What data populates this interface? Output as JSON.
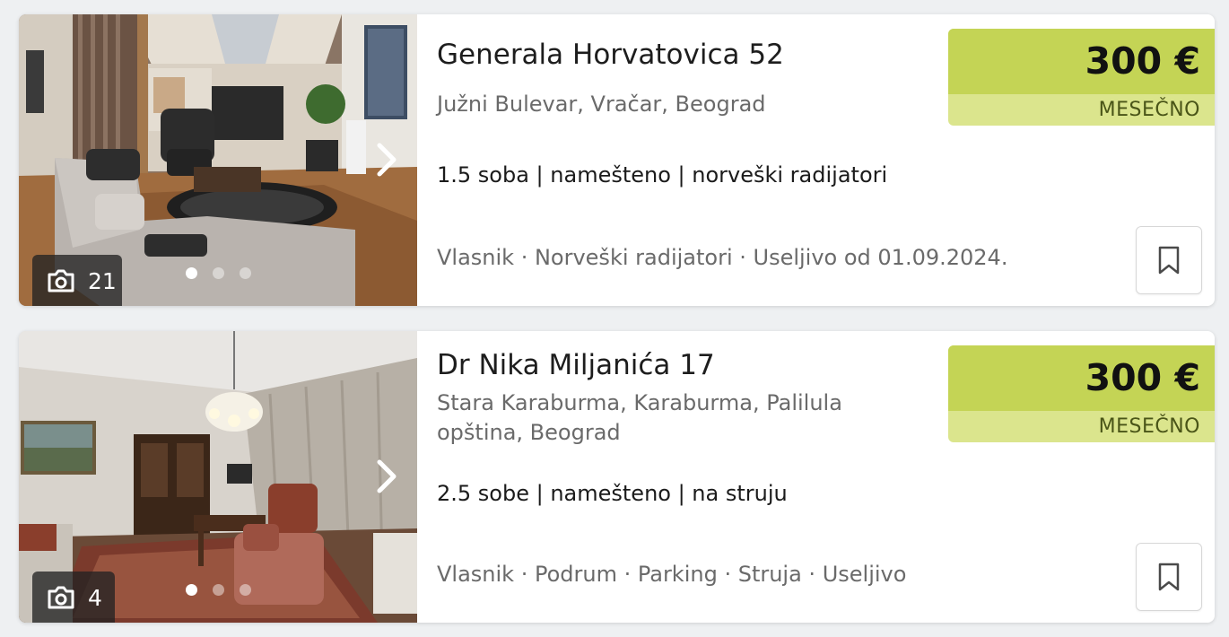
{
  "listings": [
    {
      "title": "Generala Horvatovica 52",
      "location": "Južni Bulevar, Vračar, Beograd",
      "features": "1.5 soba | namešteno | norveški radijatori",
      "meta": "Vlasnik · Norveški radijatori · Useljivo od 01.09.2024.",
      "price": "300 €",
      "period": "MESEČNO",
      "photo_count": "21",
      "photo_icon": "camera-icon",
      "next_icon": "chevron-right-icon",
      "save_icon": "bookmark-icon"
    },
    {
      "title": "Dr Nika Miljanića 17",
      "location": "Stara Karaburma, Karaburma, Palilula opština, Beograd",
      "features": "2.5 sobe | namešteno | na struju",
      "meta": "Vlasnik · Podrum · Parking · Struja · Useljivo",
      "price": "300 €",
      "period": "MESEČNO",
      "photo_count": "4",
      "photo_icon": "camera-icon",
      "next_icon": "chevron-right-icon",
      "save_icon": "bookmark-icon"
    }
  ],
  "colors": {
    "price_main": "#c4d455",
    "price_sub": "#dbe58d",
    "text_primary": "#1d1d1d",
    "text_secondary": "#6a6a6a",
    "background": "#eef0f2"
  }
}
